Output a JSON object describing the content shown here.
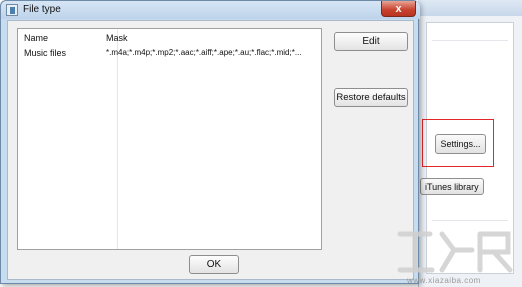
{
  "dialog": {
    "title": "File type",
    "close_label": "x",
    "columns": [
      "Name",
      "Mask"
    ],
    "rows": [
      {
        "name": "Music files",
        "mask": "*.m4a;*.m4p;*.mp2;*.aac;*.aiff;*.ape;*.au;*.flac;*.mid;*..."
      }
    ],
    "buttons": {
      "edit": "Edit",
      "restore": "Restore defaults",
      "ok": "OK"
    }
  },
  "background_window": {
    "settings_button": "Settings...",
    "itunes_button": "iTunes library"
  },
  "watermark": {
    "site": "www.xiazaiba.com"
  },
  "colors": {
    "highlight": "#e2262a",
    "title_bar": "#c8dcf0"
  }
}
